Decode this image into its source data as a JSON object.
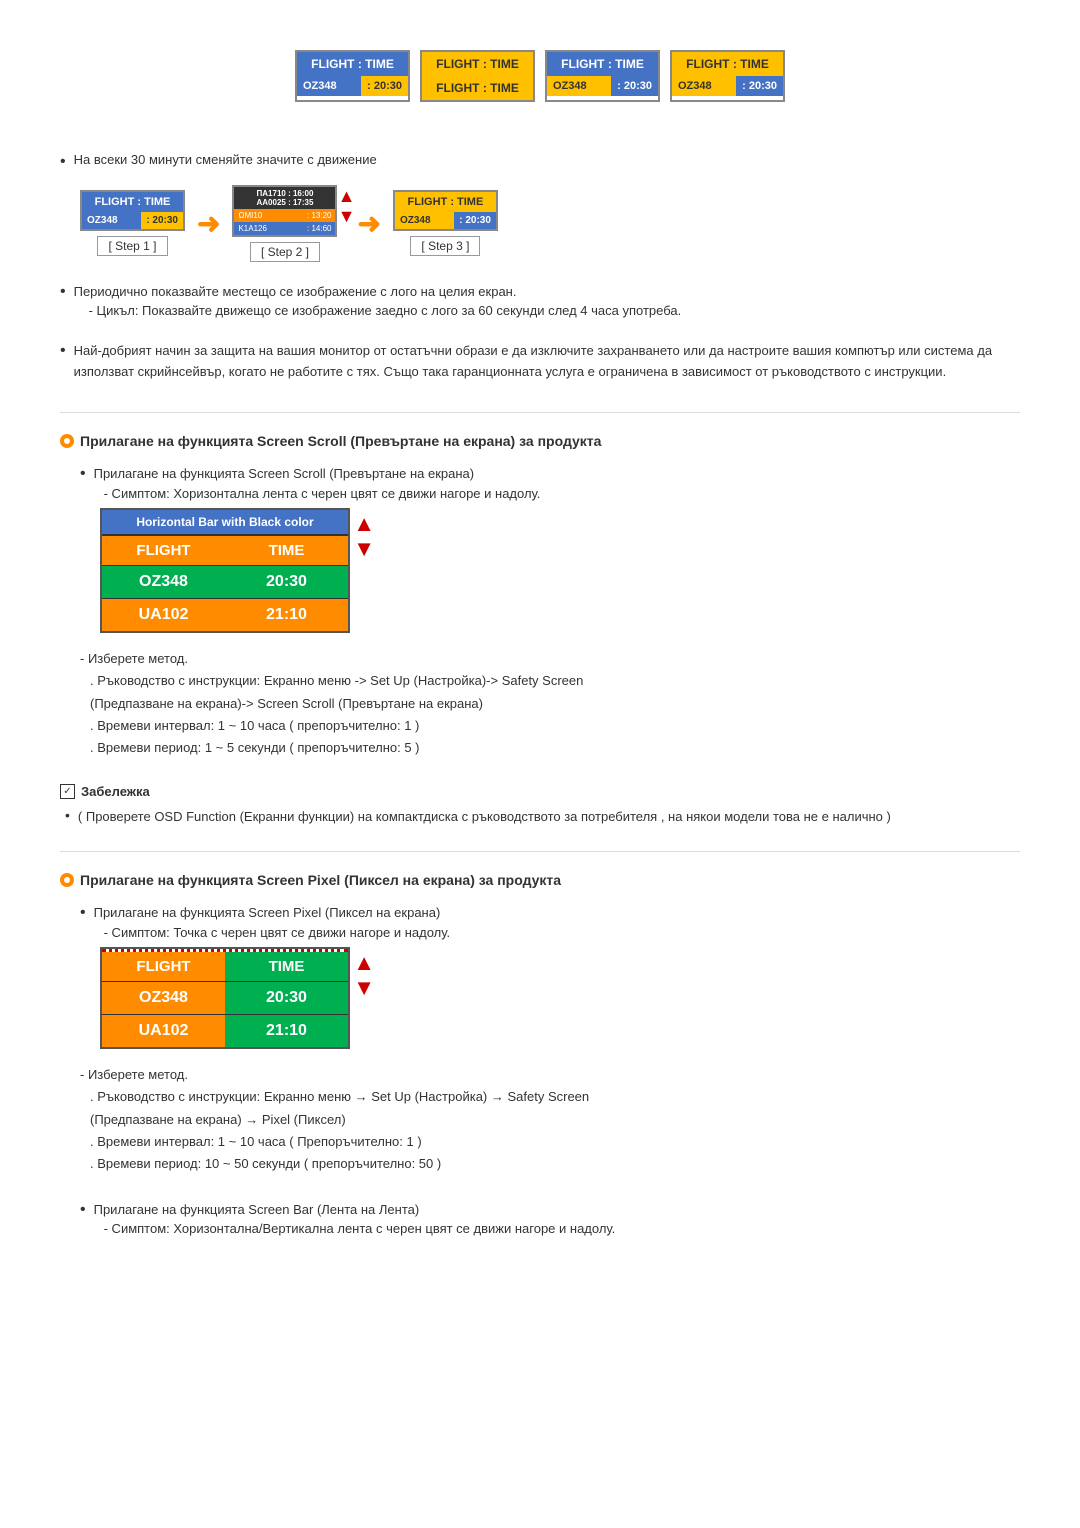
{
  "topCards": {
    "cards": [
      {
        "id": "card1",
        "topLeft": "FLIGHT : TIME",
        "topLeftBg": "#4472c4",
        "topLeftColor": "#ffffff",
        "bottomLeft": "OZ348",
        "bottomLeftBg": "#4472c4",
        "bottomLeftColor": "#ffffff",
        "bottomRight": ": 20:30",
        "bottomRightBg": "#ffc000",
        "bottomRightColor": "#333333"
      },
      {
        "id": "card2",
        "topLeft": "FLIGHT : TIME",
        "topLeftBg": "#ffc000",
        "topLeftColor": "#333333",
        "bottomLeft": "FLIGHT : TIME",
        "bottomLeftBg": "#ffc000",
        "bottomLeftColor": "#333333"
      },
      {
        "id": "card3",
        "topLeft": "FLIGHT : TIME",
        "topLeftBg": "#4472c4",
        "topLeftColor": "#ffffff",
        "bottomLeft": "OZ348",
        "bottomLeftBg": "#ffc000",
        "bottomLeftColor": "#333333",
        "bottomRight": ": 20:30",
        "bottomRightBg": "#4472c4",
        "bottomRightColor": "#ffffff"
      },
      {
        "id": "card4",
        "topLeft": "FLIGHT : TIME",
        "topLeftBg": "#ffc000",
        "topLeftColor": "#333333",
        "bottomLeft": "OZ348",
        "bottomLeftBg": "#ffc000",
        "bottomLeftColor": "#333333",
        "bottomRight": ": 20:30",
        "bottomRightBg": "#4472c4",
        "bottomRightColor": "#ffffff"
      }
    ]
  },
  "bullet1": {
    "text": "На всеки 30 минути сменяйте значите с движение"
  },
  "steps": {
    "step1Label": "[ Step 1 ]",
    "step2Label": "[ Step 2 ]",
    "step3Label": "[ Step 3 ]"
  },
  "bullet2": {
    "text": "Периодично показвайте местещо се изображение с лого на целия екран.",
    "subText": "- Цикъл: Показвайте движещо се изображение заедно с лого за 60 секунди след 4 часа употреба."
  },
  "bullet3": {
    "text": "Най-добрият начин за защита на вашия монитор от остатъчни образи е да изключите захранването или да настроите вашия компютър или система да използват скрийнсейвър, когато не работите с тях. Също така гаранционната услуга е ограничена в зависимост от ръководството с инструкции."
  },
  "screenScroll": {
    "heading": "Прилагане на функцията Screen Scroll (Превъртане на екрана) за продукта",
    "bullet1": "Прилагане на функцията Screen Scroll (Превъртане на екрана)",
    "symptom": "- Симптом: Хоризонтална лента с черен цвят се движи нагоре и надолу.",
    "tableHeader": "Horizontal Bar with Black color",
    "row1col1": "FLIGHT",
    "row1col2": "TIME",
    "row2col1": "OZ348",
    "row2col2": "20:30",
    "row3col1": "UA102",
    "row3col2": "21:10",
    "selectMethod": "- Изберете метод.",
    "instruction1": ". Ръководство с инструкции: Екранно меню -> Set Up (Настройка)-> Safety Screen",
    "instruction2": "(Предпазване на екрана)-> Screen Scroll (Превъртане на екрана)",
    "instruction3": ". Времеви интервал: 1 ~ 10 часа ( препоръчително: 1 )",
    "instruction4": ". Времеви период: 1 ~ 5 секунди ( препоръчително: 5 )"
  },
  "notes": {
    "label": "Забележка",
    "text": "( Проверете OSD Function (Екранни функции) на компактдиска с ръководството за потребителя , на някои модели това не е налично )"
  },
  "screenPixel": {
    "heading": "Прилагане на функцията Screen Pixel (Пиксел на екрана) за продукта",
    "bullet1": "Прилагане на функцията Screen Pixel (Пиксел на екрана)",
    "symptom": "- Симптом: Точка с черен цвят се движи нагоре и надолу.",
    "row1col1": "FLIGHT",
    "row1col2": "TIME",
    "row2col1": "OZ348",
    "row2col2": "20:30",
    "row3col1": "UA102",
    "row3col2": "21:10",
    "selectMethod": "- Изберете метод.",
    "instruction1": ". Ръководство с инструкции: Екранно меню → Set Up (Настройка) → Safety Screen",
    "instruction2": "(Предпазване на екрана) → Pixel (Пиксел)",
    "instruction3": ". Времеви интервал: 1 ~ 10 часа ( Препоръчително: 1 )",
    "instruction4": ". Времеви период: 10 ~ 50 секунди ( препоръчително: 50 )"
  },
  "screenBar": {
    "bullet1": "Прилагане на функцията Screen Bar (Лента на Лента)",
    "symptom": "- Симптом: Хоризонтална/Вертикална лента с черен цвят се движи нагоре и надолу."
  }
}
